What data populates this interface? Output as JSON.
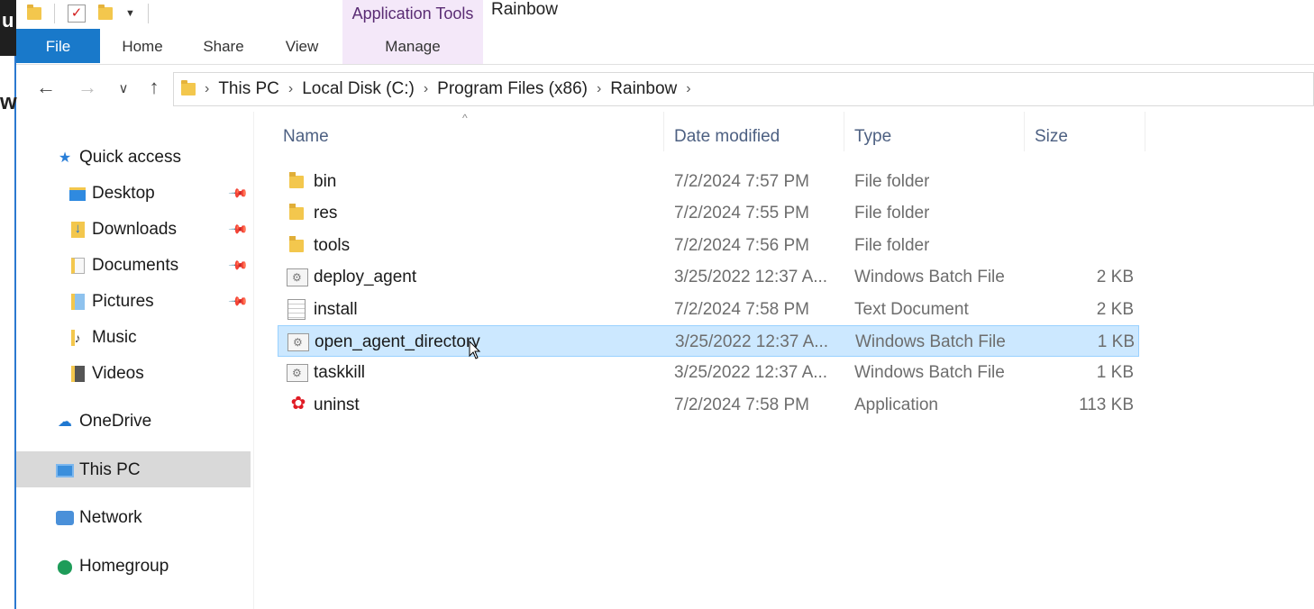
{
  "window": {
    "title": "Rainbow",
    "context_group": "Application Tools"
  },
  "ribbon": {
    "tabs": [
      "File",
      "Home",
      "Share",
      "View",
      "Manage"
    ]
  },
  "address": {
    "crumbs": [
      "This PC",
      "Local Disk (C:)",
      "Program Files (x86)",
      "Rainbow"
    ]
  },
  "nav_pane": {
    "quick_access": "Quick access",
    "pinned": [
      "Desktop",
      "Downloads",
      "Documents",
      "Pictures"
    ],
    "unpinned": [
      "Music",
      "Videos"
    ],
    "onedrive": "OneDrive",
    "this_pc": "This PC",
    "network": "Network",
    "homegroup": "Homegroup"
  },
  "columns": {
    "name": "Name",
    "date": "Date modified",
    "type": "Type",
    "size": "Size"
  },
  "files": [
    {
      "name": "bin",
      "date": "7/2/2024 7:57 PM",
      "type": "File folder",
      "size": "",
      "icon": "folder"
    },
    {
      "name": "res",
      "date": "7/2/2024 7:55 PM",
      "type": "File folder",
      "size": "",
      "icon": "folder"
    },
    {
      "name": "tools",
      "date": "7/2/2024 7:56 PM",
      "type": "File folder",
      "size": "",
      "icon": "folder"
    },
    {
      "name": "deploy_agent",
      "date": "3/25/2022 12:37 A...",
      "type": "Windows Batch File",
      "size": "2 KB",
      "icon": "batch"
    },
    {
      "name": "install",
      "date": "7/2/2024 7:58 PM",
      "type": "Text Document",
      "size": "2 KB",
      "icon": "text"
    },
    {
      "name": "open_agent_directory",
      "date": "3/25/2022 12:37 A...",
      "type": "Windows Batch File",
      "size": "1 KB",
      "icon": "batch",
      "selected": true
    },
    {
      "name": "taskkill",
      "date": "3/25/2022 12:37 A...",
      "type": "Windows Batch File",
      "size": "1 KB",
      "icon": "batch"
    },
    {
      "name": "uninst",
      "date": "7/2/2024 7:58 PM",
      "type": "Application",
      "size": "113 KB",
      "icon": "app"
    }
  ],
  "colors": {
    "file_tab": "#1979ca",
    "selection": "#cce8ff",
    "context_tab": "#f4e8f9"
  }
}
